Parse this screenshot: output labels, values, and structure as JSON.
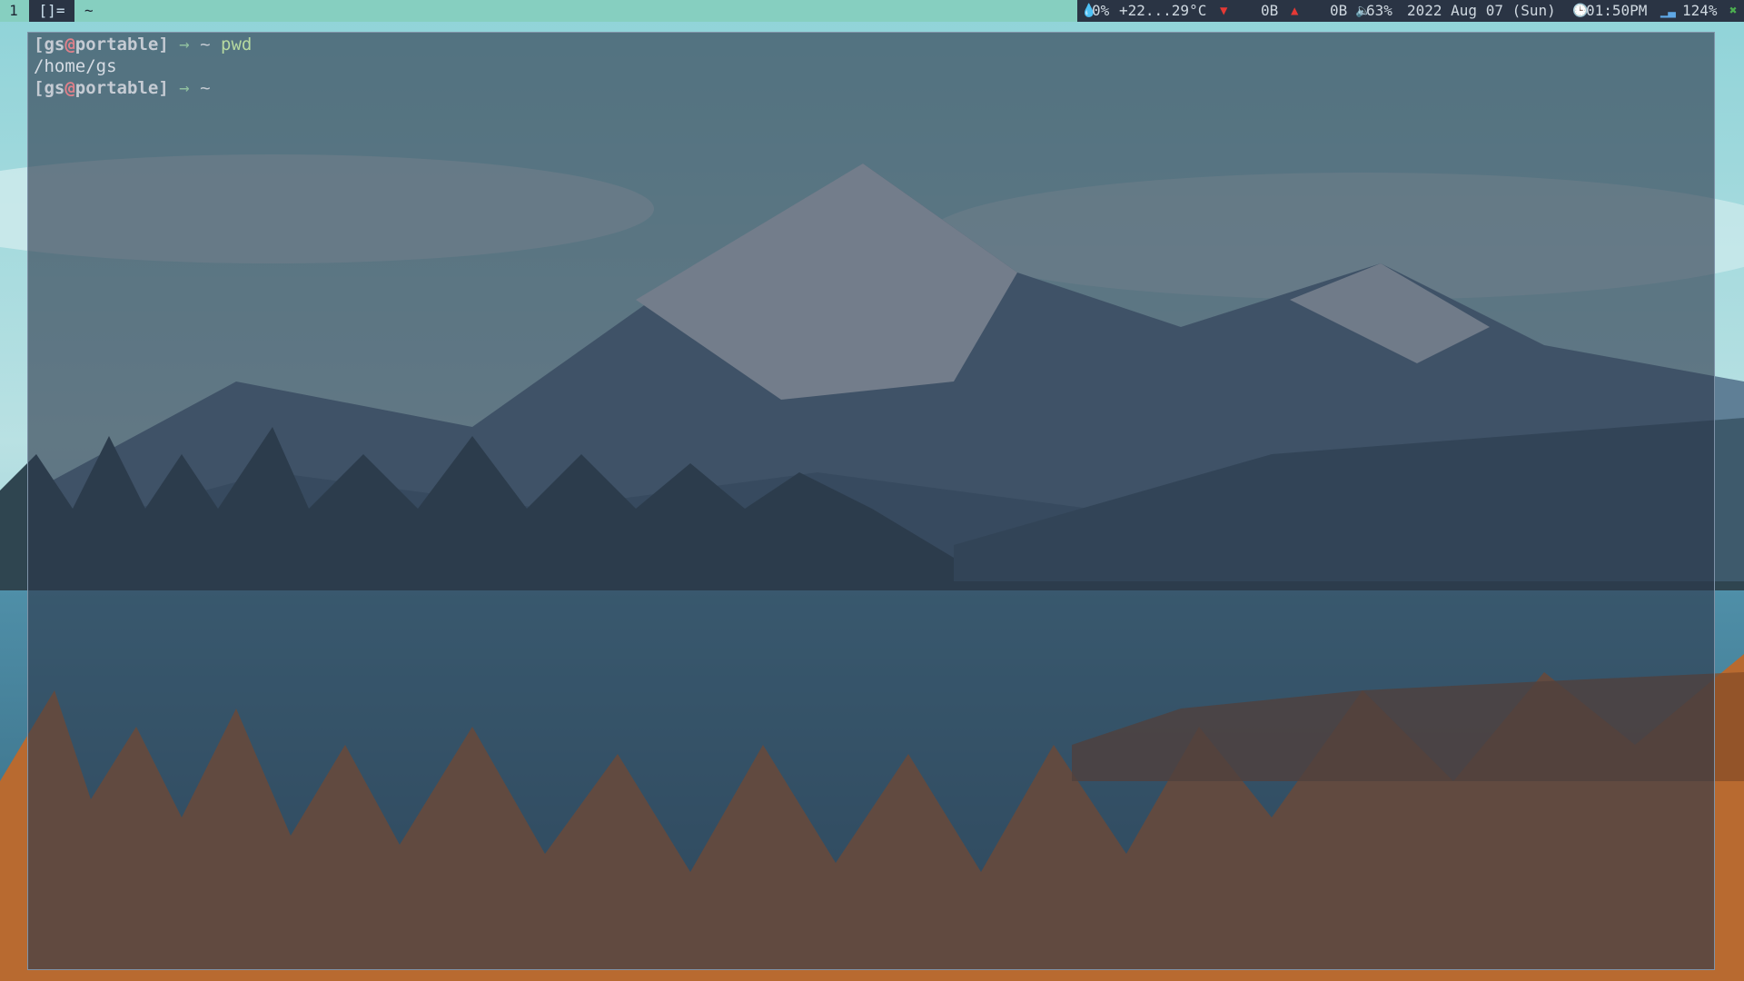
{
  "topbar": {
    "workspace": "1",
    "layout_symbol": "[]=",
    "window_title": "~",
    "status": {
      "drop_icon": "water-drop-icon",
      "humidity": "0%",
      "temperature": "+22...29°C",
      "down_icon": "download-arrow-icon",
      "down_rate": "0B",
      "up_icon": "upload-arrow-icon",
      "up_rate": "0B",
      "volume_icon": "speaker-icon",
      "volume": "63%",
      "date": "2022 Aug 07 (Sun)",
      "clock_icon": "clock-icon",
      "time": "01:50PM",
      "signal_icon": "wifi-signal-icon",
      "brightness": "124%",
      "close_icon": "close-icon"
    }
  },
  "terminal": {
    "prompt": {
      "user": "gs",
      "at": "@",
      "host": "portable",
      "arrow": "→",
      "cwd": "~"
    },
    "lines": [
      {
        "command": "pwd"
      },
      {
        "output": "/home/gs"
      },
      {
        "command": ""
      }
    ]
  },
  "colors": {
    "bar_bg": "#86cfc0",
    "status_bg": "#2a3444",
    "at_sign": "#e0808a",
    "down_arrow": "#e53935",
    "up_arrow": "#e53935",
    "close_icon": "#4caf50"
  }
}
